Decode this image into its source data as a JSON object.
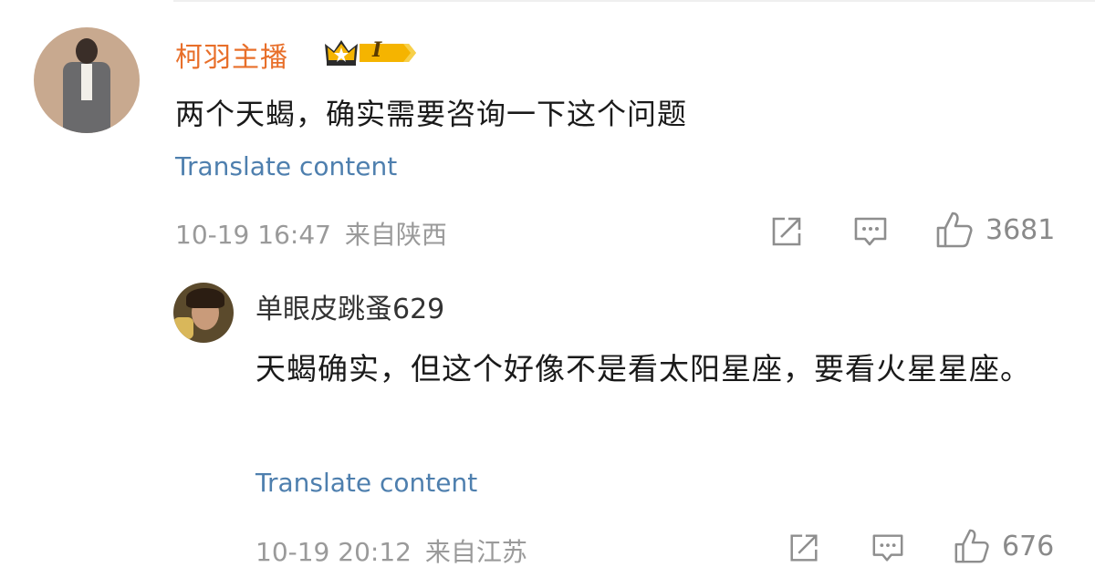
{
  "main_comment": {
    "user_name": "柯羽主播",
    "vip_level": "I",
    "text": "两个天蝎，确实需要咨询一下这个问题",
    "translate_label": "Translate content",
    "time": "10-19 16:47",
    "location": "来自陕西",
    "like_count": "3681"
  },
  "reply": {
    "user_name": "单眼皮跳蚤629",
    "text": "天蝎确实，但这个好像不是看太阳星座，要看火星星座。",
    "translate_label": "Translate content",
    "time": "10-19 20:12",
    "location": "来自江苏",
    "like_count": "676"
  },
  "icons": {
    "share": "share-icon",
    "comment": "comment-icon",
    "like": "thumbs-up-icon"
  },
  "colors": {
    "user_name_vip": "#e86f2a",
    "link": "#4e7fae",
    "meta": "#9a9a9a",
    "badge_gold": "#f5b400"
  }
}
